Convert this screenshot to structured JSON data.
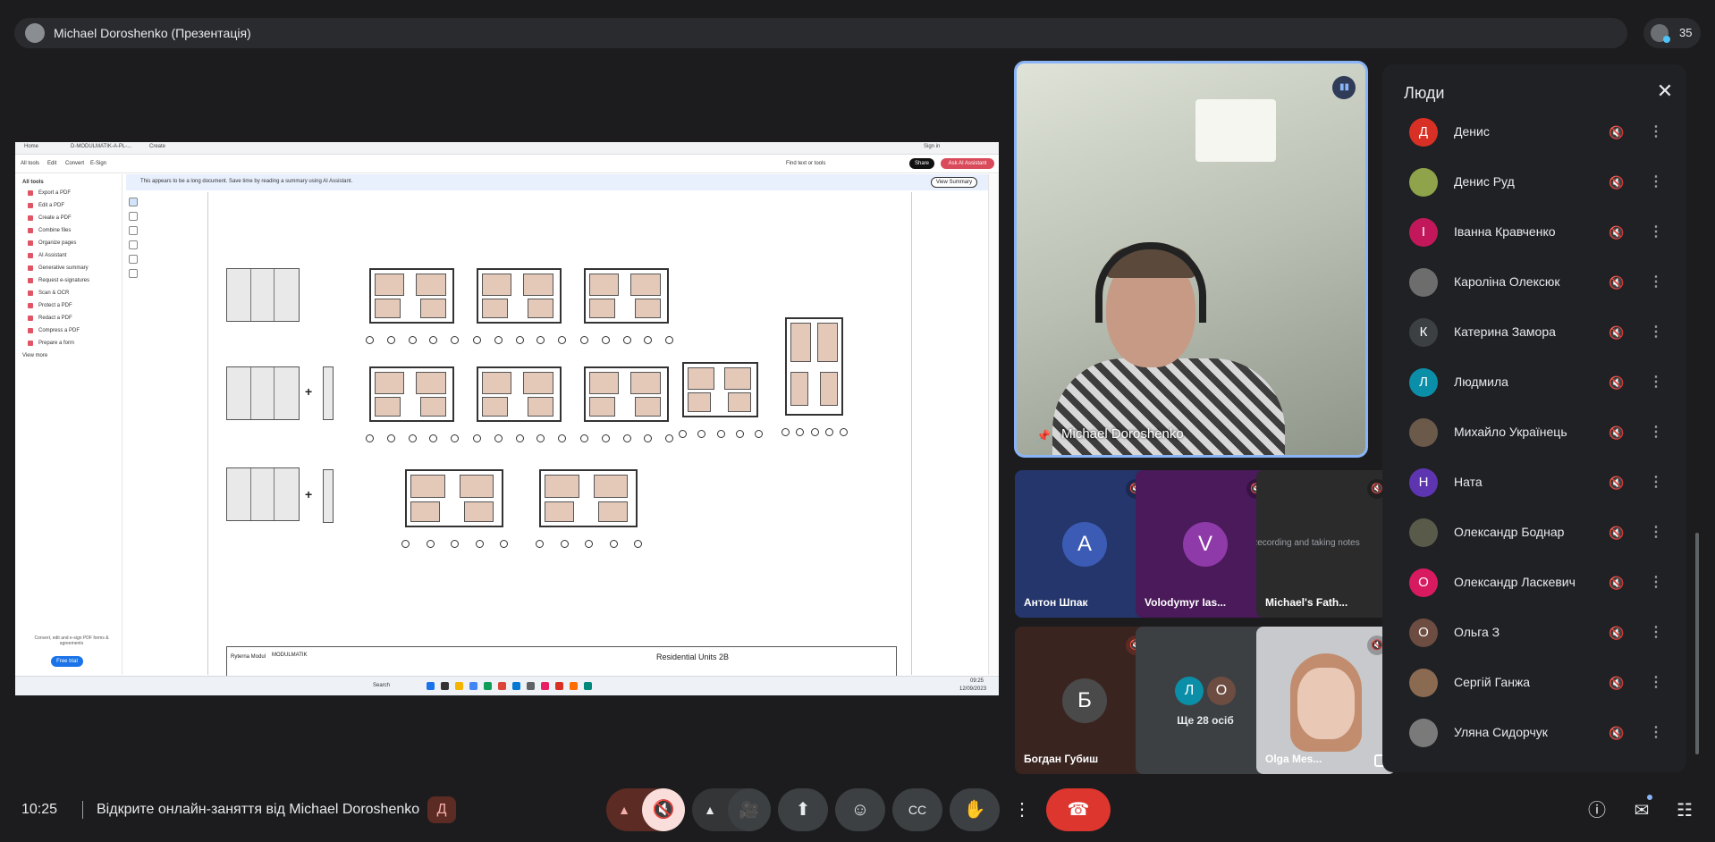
{
  "topbar": {
    "presenter_label": "Michael Doroshenko (Презентація)",
    "participant_count": "35"
  },
  "shared_screen": {
    "tabs": [
      "Home",
      "D-MODULMATIK-A-PL-...",
      "Create"
    ],
    "menus": [
      "All tools",
      "Edit",
      "Convert",
      "E-Sign"
    ],
    "find_text": "Find text or tools",
    "sign_in": "Sign in",
    "share_label": "Share",
    "ai_label": "Ask AI Assistant",
    "notice": "This appears to be a long document. Save time by reading a summary using AI Assistant.",
    "view_summary": "View Summary",
    "sidebar_title": "All tools",
    "sidebar_items": [
      "Export a PDF",
      "Edit a PDF",
      "Create a PDF",
      "Combine files",
      "Organize pages",
      "AI Assistant",
      "Generative summary",
      "Request e-signatures",
      "Scan & OCR",
      "Protect a PDF",
      "Redact a PDF",
      "Compress a PDF",
      "Prepare a form",
      "View more"
    ],
    "trial_text": "Convert, edit and e-sign PDF forms & agreements",
    "free_trial": "Free trial",
    "titleblock_title": "Residential Units 2B",
    "titleblock_company": "MODULMATIK",
    "titleblock_client": "Ryterna Modul",
    "taskbar_search": "Search",
    "taskbar_time": "09:25",
    "taskbar_date": "12/09/2023"
  },
  "main_video": {
    "name": "Michael Doroshenko"
  },
  "tiles": [
    {
      "initial": "А",
      "name": "Антон Шпак",
      "bg": "#24366b",
      "avatar_bg": "#3b5bb5"
    },
    {
      "initial": "V",
      "name": "Volodymyr Ias...",
      "bg": "#4a1a5a",
      "avatar_bg": "#8e3aa8"
    },
    {
      "name": "Michael's Fath...",
      "caption": "Recording and taking notes",
      "bg": "#2b2b2b"
    },
    {
      "initial": "Б",
      "name": "Богдан Губиш",
      "bg": "#3a2420",
      "avatar_bg": "#4a4a4a"
    },
    {
      "more_label": "Ще 28 осіб",
      "av1": "Л",
      "av2": "О",
      "bg": "#3c4043"
    },
    {
      "name": "Olga Mes...",
      "bg": "#c7c9cc"
    }
  ],
  "people_panel": {
    "title": "Люди",
    "people": [
      {
        "initial": "Д",
        "name": "Денис",
        "color": "#d93025"
      },
      {
        "initial": "",
        "name": "Денис Руд",
        "color": "#8fa34a"
      },
      {
        "initial": "І",
        "name": "Іванна Кравченко",
        "color": "#c2185b"
      },
      {
        "initial": "",
        "name": "Кароліна Олексюк",
        "color": "#6d6d6d"
      },
      {
        "initial": "К",
        "name": "Катерина Замора",
        "color": "#3c4043"
      },
      {
        "initial": "Л",
        "name": "Людмила",
        "color": "#0b8fa8"
      },
      {
        "initial": "",
        "name": "Михайло Українець",
        "color": "#6b5a4a"
      },
      {
        "initial": "Н",
        "name": "Ната",
        "color": "#5e35b1"
      },
      {
        "initial": "",
        "name": "Олександр Боднар",
        "color": "#5a5a4a"
      },
      {
        "initial": "О",
        "name": "Олександр Ласкевич",
        "color": "#d81b60"
      },
      {
        "initial": "О",
        "name": "Ольга З",
        "color": "#6d4c41"
      },
      {
        "initial": "",
        "name": "Сергій Ганжа",
        "color": "#8a6a50"
      },
      {
        "initial": "",
        "name": "Уляна Сидорчук",
        "color": "#7a7a7a"
      }
    ]
  },
  "bottom": {
    "time": "10:25",
    "meeting_title": "Відкрите онлайн-заняття від Michael Doroshenko",
    "badge": "Д"
  }
}
